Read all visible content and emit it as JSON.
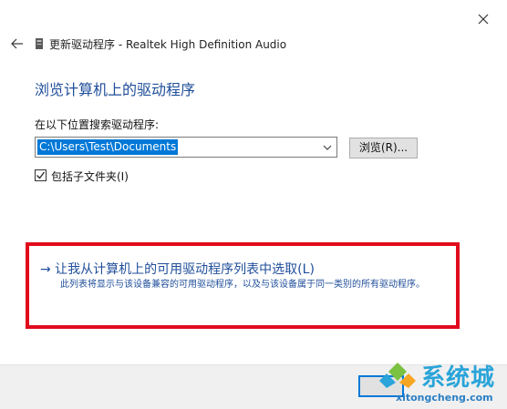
{
  "window": {
    "title": "更新驱动程序 - Realtek High Definition Audio",
    "close_icon": "close-icon",
    "back_icon": "back-arrow-icon",
    "device_icon": "device-icon"
  },
  "content": {
    "heading": "浏览计算机上的驱动程序",
    "search_label": "在以下位置搜索驱动程序:",
    "path_value": "C:\\Users\\Test\\Documents",
    "browse_label": "浏览(R)...",
    "include_subfolders_label": "包括子文件夹(I)",
    "include_subfolders_checked": true
  },
  "pick_option": {
    "link_text": "→ 让我从计算机上的可用驱动程序列表中选取(L)",
    "description": "此列表将显示与该设备兼容的可用驱动程序，以及与该设备属于同一类别的所有驱动程序。"
  },
  "footer": {
    "next_label": ""
  },
  "watermark": {
    "brand": "系统城",
    "url": "xitongcheng.com"
  },
  "colors": {
    "accent_blue": "#1f4e9a",
    "selection_blue": "#0078d7",
    "highlight_red": "#e00b1c",
    "watermark_blue": "#2aa4d9"
  }
}
